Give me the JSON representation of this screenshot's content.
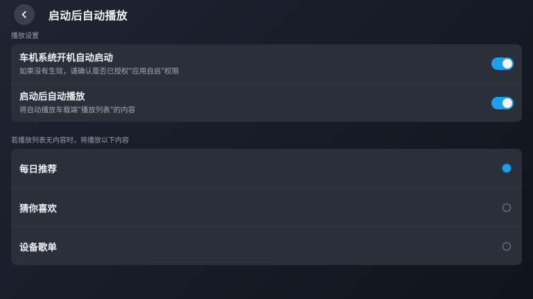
{
  "header": {
    "title": "启动后自动播放",
    "back_icon": "chevron-left-icon"
  },
  "playback_section": {
    "label": "播放设置",
    "rows": [
      {
        "title": "车机系统开机自动启动",
        "subtitle": "如果没有生效，请确认是否已授权\"应用自启\"权限",
        "enabled": true
      },
      {
        "title": "启动后自动播放",
        "subtitle": "将自动播放车载端\"播放列表\"的内容",
        "enabled": true
      }
    ]
  },
  "fallback_section": {
    "label": "若播放列表无内容时，将播放以下内容",
    "options": [
      {
        "label": "每日推荐",
        "selected": true
      },
      {
        "label": "猜你喜欢",
        "selected": false
      },
      {
        "label": "设备歌单",
        "selected": false
      }
    ]
  },
  "colors": {
    "accent": "#1aa0f0",
    "card": "#2a2f39"
  }
}
